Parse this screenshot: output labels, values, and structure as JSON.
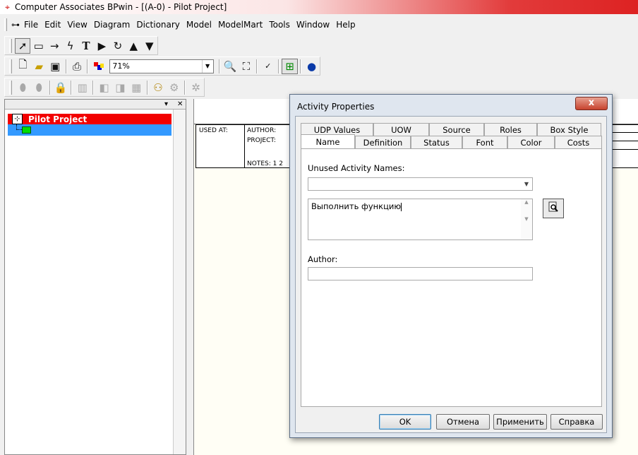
{
  "window": {
    "title": "Computer Associates BPwin - [(A-0)  - Pilot Project]"
  },
  "menubar": {
    "items": [
      "File",
      "Edit",
      "View",
      "Diagram",
      "Dictionary",
      "Model",
      "ModelMart",
      "Tools",
      "Window",
      "Help"
    ]
  },
  "toolbar": {
    "zoom_value": "71%",
    "tools": [
      "pointer-tool",
      "box-tool",
      "arrow-tool",
      "squiggle-tool",
      "text-tool",
      "go-to-sibling",
      "off-page-reference",
      "go-to-parent",
      "go-to-child"
    ]
  },
  "model_explorer": {
    "root_label": "Pilot Project",
    "child_label": ""
  },
  "diagram": {
    "used_at": "USED AT:",
    "author": "AUTHOR:",
    "project": "PROJECT:",
    "notes": "NOTES:  1  2"
  },
  "dialog": {
    "title": "Activity Properties",
    "close_glyph": "x",
    "tabs_row1": [
      "UDP Values",
      "UOW",
      "Source",
      "Roles",
      "Box Style"
    ],
    "tabs_row2": [
      "Name",
      "Definition",
      "Status",
      "Font",
      "Color",
      "Costs"
    ],
    "active_tab": "Name",
    "unused_names_label": "Unused Activity Names:",
    "unused_names_value": "",
    "name_value": "Выполнить функцию",
    "author_label": "Author:",
    "author_value": "",
    "buttons": {
      "ok": "OK",
      "cancel": "Отмена",
      "apply": "Применить",
      "help": "Справка"
    }
  },
  "colors": {
    "selection_red": "#f20000",
    "selection_blue": "#3399ff",
    "activity_green": "#00dd00"
  }
}
